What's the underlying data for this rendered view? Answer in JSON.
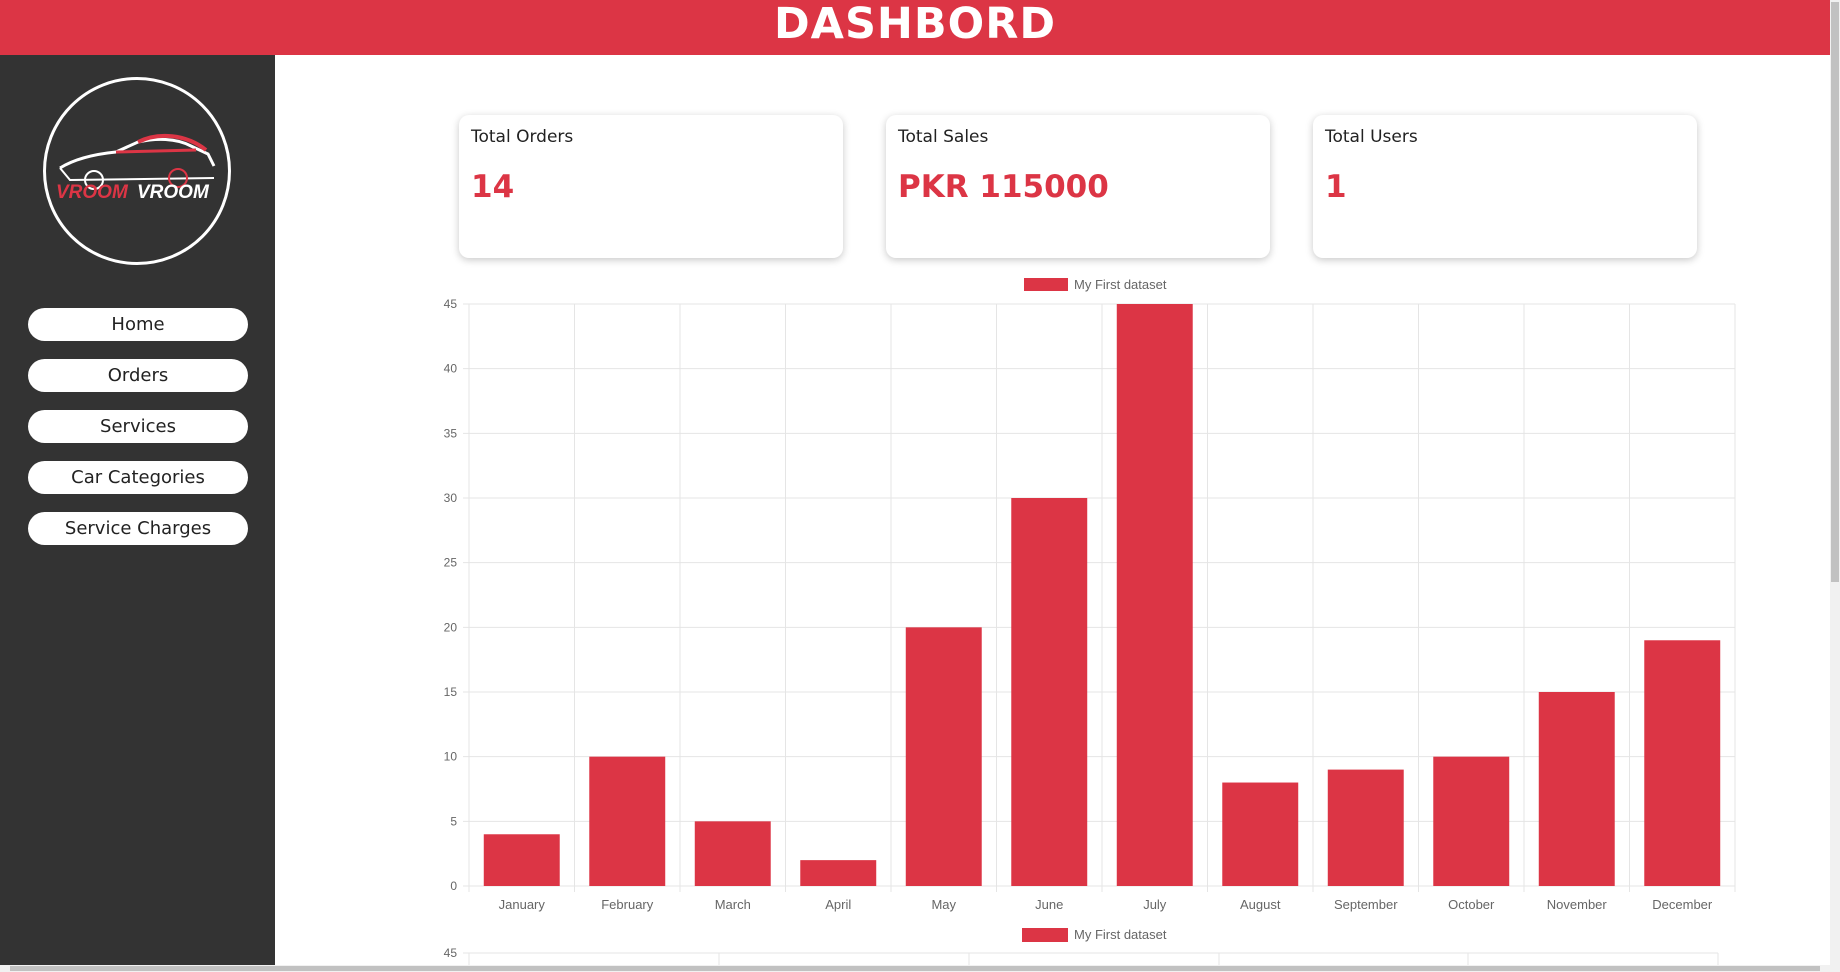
{
  "header": {
    "title": "DASHBORD"
  },
  "brand": {
    "logo_text_part1": "VROOM",
    "logo_text_part2": "VROOM"
  },
  "sidebar": {
    "items": [
      {
        "label": "Home"
      },
      {
        "label": "Orders"
      },
      {
        "label": "Services"
      },
      {
        "label": "Car Categories"
      },
      {
        "label": "Service Charges"
      }
    ]
  },
  "cards": [
    {
      "label": "Total Orders",
      "value": "14"
    },
    {
      "label": "Total Sales",
      "value": "PKR 115000"
    },
    {
      "label": "Total Users",
      "value": "1"
    }
  ],
  "colors": {
    "accent": "#dc3545",
    "sidebar": "#333333"
  },
  "chart_data": [
    {
      "type": "bar",
      "title": "",
      "legend": {
        "placement": "top-center",
        "entries": [
          "My First dataset"
        ]
      },
      "categories": [
        "January",
        "February",
        "March",
        "April",
        "May",
        "June",
        "July",
        "August",
        "September",
        "October",
        "November",
        "December"
      ],
      "series": [
        {
          "name": "My First dataset",
          "values": [
            4,
            10,
            5,
            2,
            20,
            30,
            45,
            8,
            9,
            10,
            15,
            19
          ],
          "color": "#dc3545"
        }
      ],
      "ylim": [
        0,
        45
      ],
      "yticks": [
        0,
        5,
        10,
        15,
        20,
        25,
        30,
        35,
        40,
        45
      ],
      "grid": true
    },
    {
      "type": "bar",
      "title": "",
      "legend": {
        "placement": "top-center",
        "entries": [
          "My First dataset"
        ]
      },
      "partially_visible": true,
      "yticks_visible": [
        45
      ]
    }
  ]
}
